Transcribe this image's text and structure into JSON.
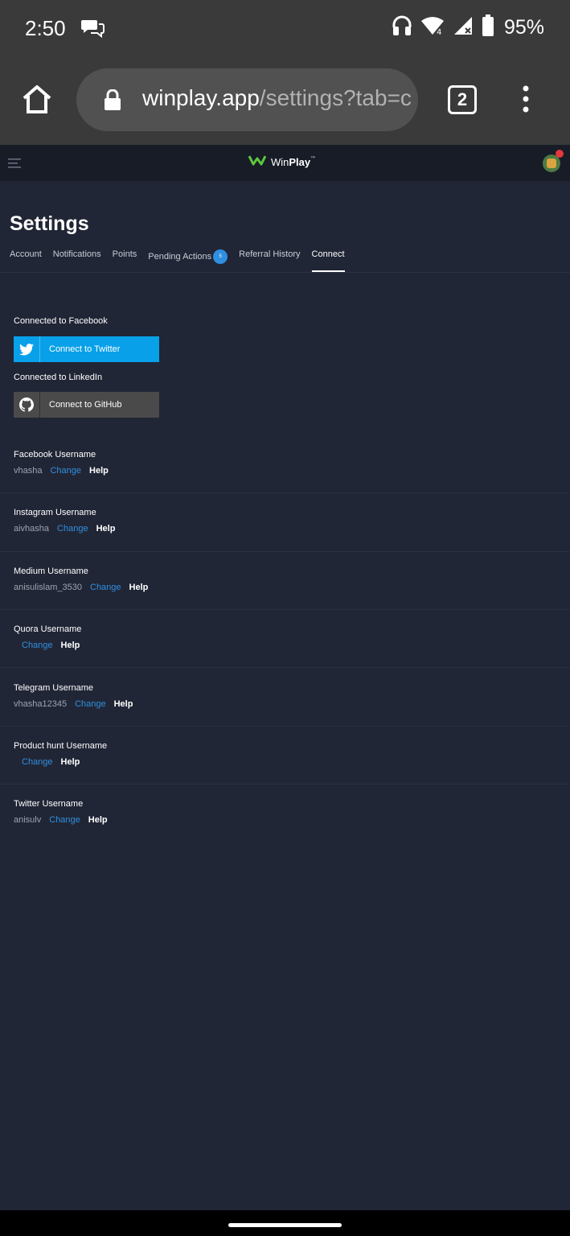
{
  "status_bar": {
    "time": "2:50",
    "battery": "95%"
  },
  "browser": {
    "url_domain": "winplay.app",
    "url_path": "/settings?tab=c",
    "tab_count": "2"
  },
  "app": {
    "brand_prefix": "Win",
    "brand_bold": "Play",
    "brand_tm": "™"
  },
  "settings": {
    "title": "Settings",
    "tabs": [
      {
        "label": "Account"
      },
      {
        "label": "Notifications"
      },
      {
        "label": "Points"
      },
      {
        "label": "Pending Actions",
        "badge": "5"
      },
      {
        "label": "Referral History"
      },
      {
        "label": "Connect"
      }
    ],
    "active_tab": "Connect"
  },
  "connect": {
    "facebook_status": "Connected to Facebook",
    "twitter_button": "Connect to Twitter",
    "linkedin_status": "Connected to LinkedIn",
    "github_button": "Connect to GitHub"
  },
  "usernames": [
    {
      "label": "Facebook Username",
      "value": "vhasha"
    },
    {
      "label": "Instagram Username",
      "value": "aivhasha"
    },
    {
      "label": "Medium Username",
      "value": "anisulislam_3530"
    },
    {
      "label": "Quora Username",
      "value": ""
    },
    {
      "label": "Telegram Username",
      "value": "vhasha12345"
    },
    {
      "label": "Product hunt Username",
      "value": ""
    },
    {
      "label": "Twitter Username",
      "value": "anisulv"
    }
  ],
  "actions": {
    "change": "Change",
    "help": "Help"
  },
  "colors": {
    "accent": "#2f8fe0",
    "twitter": "#08a0e9",
    "background": "#212636"
  }
}
